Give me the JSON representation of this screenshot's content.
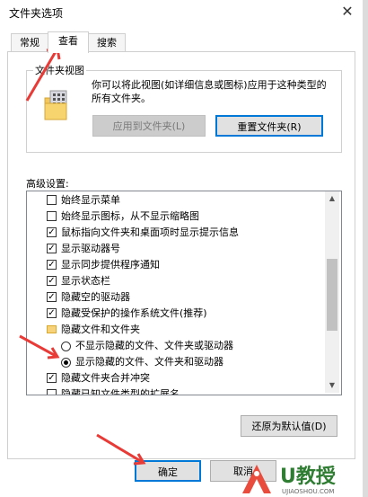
{
  "window": {
    "title": "文件夹选项",
    "close_glyph": "✕"
  },
  "tabs": [
    {
      "label": "常规",
      "active": false
    },
    {
      "label": "查看",
      "active": true
    },
    {
      "label": "搜索",
      "active": false
    }
  ],
  "folder_views": {
    "group_title": "文件夹视图",
    "description": "你可以将此视图(如详细信息或图标)应用于这种类型的所有文件夹。",
    "apply_button": "应用到文件夹(L)",
    "reset_button": "重置文件夹(R)"
  },
  "advanced": {
    "label": "高级设置:",
    "items": [
      {
        "type": "checkbox",
        "checked": false,
        "label": "始终显示菜单"
      },
      {
        "type": "checkbox",
        "checked": false,
        "label": "始终显示图标，从不显示缩略图"
      },
      {
        "type": "checkbox",
        "checked": true,
        "label": "鼠标指向文件夹和桌面项时显示提示信息"
      },
      {
        "type": "checkbox",
        "checked": true,
        "label": "显示驱动器号"
      },
      {
        "type": "checkbox",
        "checked": true,
        "label": "显示同步提供程序通知"
      },
      {
        "type": "checkbox",
        "checked": true,
        "label": "显示状态栏"
      },
      {
        "type": "checkbox",
        "checked": true,
        "label": "隐藏空的驱动器"
      },
      {
        "type": "checkbox",
        "checked": true,
        "label": "隐藏受保护的操作系统文件(推荐)"
      },
      {
        "type": "folder",
        "label": "隐藏文件和文件夹"
      },
      {
        "type": "radio",
        "checked": false,
        "label": "不显示隐藏的文件、文件夹或驱动器"
      },
      {
        "type": "radio",
        "checked": true,
        "label": "显示隐藏的文件、文件夹和驱动器"
      },
      {
        "type": "checkbox",
        "checked": true,
        "label": "隐藏文件夹合并冲突"
      },
      {
        "type": "checkbox",
        "checked": false,
        "label": "隐藏已知文件类型的扩展名"
      }
    ]
  },
  "restore_defaults_button": "还原为默认值(D)",
  "footer": {
    "ok_button": "确定",
    "cancel_button": "取消"
  },
  "watermark": {
    "text": "U教授",
    "url": "UJIAOSHOU.COM"
  },
  "colors": {
    "annotation_arrow": "#e83a36",
    "focus_border": "#0078d7"
  }
}
